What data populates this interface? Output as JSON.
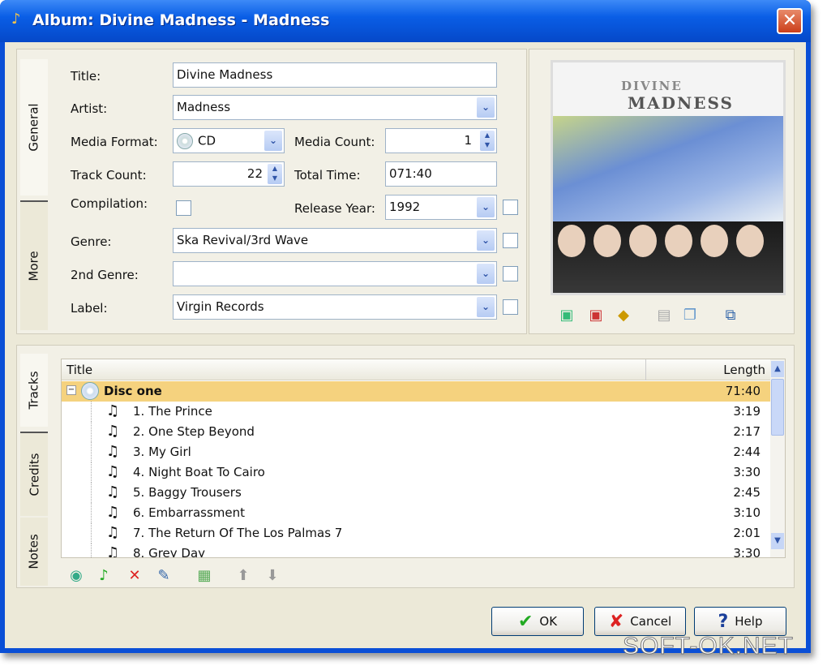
{
  "window": {
    "title": "Album: Divine Madness - Madness",
    "close_label": "✕"
  },
  "top_tabs": [
    "General",
    "More"
  ],
  "form": {
    "title_label": "Title:",
    "title_value": "Divine Madness",
    "artist_label": "Artist:",
    "artist_value": "Madness",
    "media_format_label": "Media Format:",
    "media_format_value": "CD",
    "media_count_label": "Media Count:",
    "media_count_value": "1",
    "track_count_label": "Track Count:",
    "track_count_value": "22",
    "total_time_label": "Total Time:",
    "total_time_value": "071:40",
    "compilation_label": "Compilation:",
    "compilation_checked": false,
    "release_year_label": "Release Year:",
    "release_year_value": "1992",
    "genre_label": "Genre:",
    "genre_value": "Ska Revival/3rd Wave",
    "genre2_label": "2nd Genre:",
    "genre2_value": "",
    "label_label": "Label:",
    "label_value": "Virgin Records"
  },
  "cover": {
    "text_left": "DIVINE",
    "text_right": "MADNESS"
  },
  "bottom_tabs": [
    "Tracks",
    "Credits",
    "Notes"
  ],
  "tracklist": {
    "headers": {
      "title": "Title",
      "length": "Length"
    },
    "disc": {
      "title": "Disc one",
      "length": "71:40"
    },
    "tracks": [
      {
        "title": "1. The Prince",
        "length": "3:19"
      },
      {
        "title": "2. One Step Beyond",
        "length": "2:17"
      },
      {
        "title": "3. My Girl",
        "length": "2:44"
      },
      {
        "title": "4. Night Boat To Cairo",
        "length": "3:30"
      },
      {
        "title": "5. Baggy Trousers",
        "length": "2:45"
      },
      {
        "title": "6. Embarrassment",
        "length": "3:10"
      },
      {
        "title": "7. The Return Of The Los Palmas 7",
        "length": "2:01"
      },
      {
        "title": "8. Grey Day",
        "length": "3:30"
      }
    ]
  },
  "buttons": {
    "ok": "OK",
    "cancel": "Cancel",
    "help": "Help"
  },
  "watermark": "SOFT-OK.NET",
  "colors": {
    "titlebar": "#0a5ee6",
    "selected_row": "#f5d27e",
    "dialog_bg": "#ece9d8"
  }
}
